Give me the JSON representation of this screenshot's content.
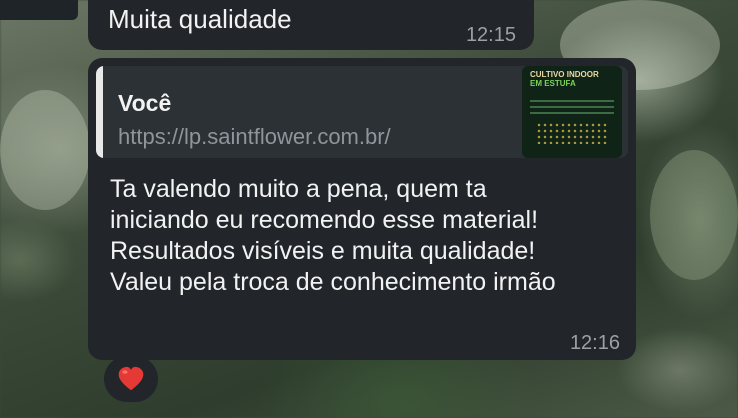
{
  "messages": [
    {
      "text": "Muita qualidade",
      "time": "12:15"
    },
    {
      "quote": {
        "author": "Você",
        "link": "https://lp.saintflower.com.br/",
        "thumbnail_title": "CULTIVO INDOOR",
        "thumbnail_subtitle": "EM ESTUFA"
      },
      "text": "Ta valendo muito a pena, quem ta iniciando eu recomendo esse material! Resultados visíveis e muita qualidade! Valeu pela troca de conhecimento irmão",
      "time": "12:16",
      "reaction": "❤️"
    }
  ],
  "colors": {
    "bubble": "#22262b",
    "quote_bg": "#2c3136",
    "time": "#9aa0a6",
    "link": "#8e959b",
    "heart": "#e53935"
  }
}
